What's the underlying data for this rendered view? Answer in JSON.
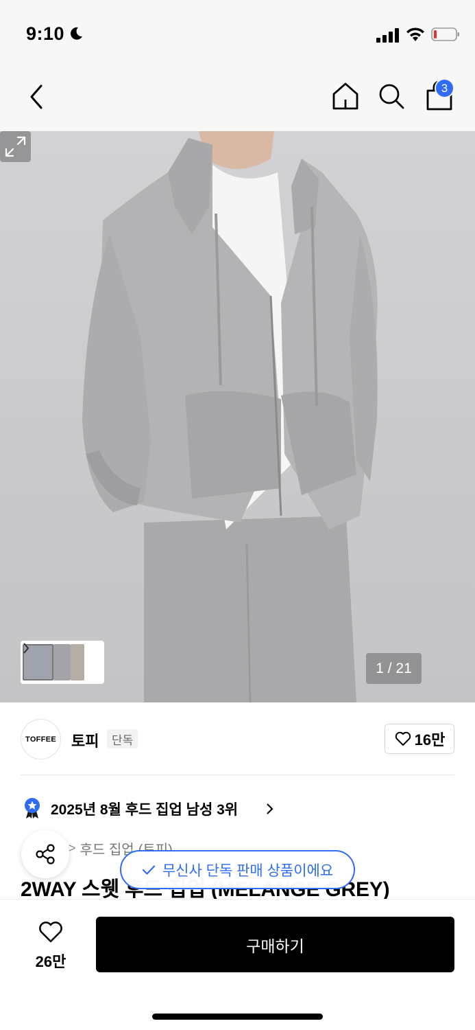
{
  "status_bar": {
    "time": "9:10"
  },
  "nav": {
    "cart_count": "3"
  },
  "hero": {
    "counter": "1 / 21"
  },
  "brand": {
    "logo_text": "TOFFEE",
    "name": "토피",
    "tag": "단독",
    "likes": "16만"
  },
  "ranking": {
    "text": "2025년 8월 후드 집업 남성 3위"
  },
  "breadcrumb": {
    "items": [
      "후드 집업",
      "(토피)"
    ]
  },
  "product": {
    "title": "2WAY 스웻 후드 집업 (MELANGE GREY)"
  },
  "toast": {
    "text": "무신사 단독 판매 상품이에요"
  },
  "bottom_bar": {
    "wish_count": "26만",
    "buy_label": "구매하기"
  },
  "colors": {
    "accent": "#2f6bf3",
    "buy_button": "#000000"
  }
}
